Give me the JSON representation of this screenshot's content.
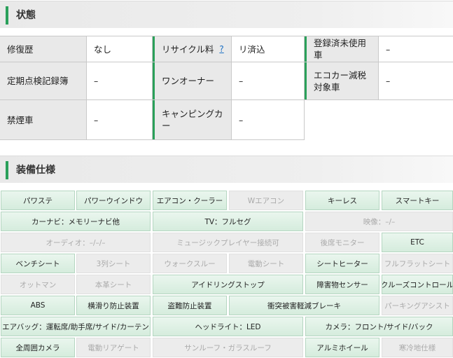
{
  "status": {
    "title": "状態",
    "rows": [
      [
        {
          "label": "修復歴",
          "value": "なし"
        },
        {
          "label": "リサイクル料",
          "help": "?",
          "value": "リ済込"
        },
        {
          "label": "登録済未使用車",
          "value": "–"
        }
      ],
      [
        {
          "label": "定期点検記録簿",
          "value": "–"
        },
        {
          "label": "ワンオーナー",
          "value": "–"
        },
        {
          "label": "エコカー減税対象車",
          "value": "–"
        }
      ],
      [
        {
          "label": "禁煙車",
          "value": "–"
        },
        {
          "label": "キャンピングカー",
          "value": "–"
        }
      ]
    ]
  },
  "equipment": {
    "title": "装備仕様",
    "items": [
      {
        "label": "パワステ",
        "on": true
      },
      {
        "label": "パワーウインドウ",
        "on": true
      },
      {
        "label": "エアコン・クーラー",
        "on": true
      },
      {
        "label": "Wエアコン",
        "on": false
      },
      {
        "label": "キーレス",
        "on": true
      },
      {
        "label": "スマートキー",
        "on": true
      },
      {
        "label": "カーナビ：メモリーナビ他",
        "on": true
      },
      {
        "label": "TV：フルセグ",
        "on": true
      },
      {
        "label": "映像：–/–",
        "on": false
      },
      {
        "label": "オーディオ：–/–/–",
        "on": false
      },
      {
        "label": "ミュージックプレイヤー接続可",
        "on": false
      },
      {
        "label": "後席モニター",
        "on": false
      },
      {
        "label": "ETC",
        "on": true
      },
      {
        "label": "ベンチシート",
        "on": true
      },
      {
        "label": "3列シート",
        "on": false
      },
      {
        "label": "ウォークスルー",
        "on": false
      },
      {
        "label": "電動シート",
        "on": false
      },
      {
        "label": "シートヒーター",
        "on": true
      },
      {
        "label": "フルフラットシート",
        "on": false
      },
      {
        "label": "オットマン",
        "on": false
      },
      {
        "label": "本革シート",
        "on": false
      },
      {
        "label": "アイドリングストップ",
        "on": true
      },
      {
        "label": "障害物センサー",
        "on": true
      },
      {
        "label": "クルーズコントロール",
        "on": true
      },
      {
        "label": "ABS",
        "on": true
      },
      {
        "label": "横滑り防止装置",
        "on": true
      },
      {
        "label": "盗難防止装置",
        "on": true
      },
      {
        "label": "衝突被害軽減ブレーキ",
        "on": true
      },
      {
        "label": "パーキングアシスト",
        "on": false
      },
      {
        "label": "エアバッグ：運転席/助手席/サイド/カーテン",
        "on": true
      },
      {
        "label": "ヘッドライト：LED",
        "on": true
      },
      {
        "label": "カメラ：フロント/サイド/バック",
        "on": true
      },
      {
        "label": "全周囲カメラ",
        "on": true
      },
      {
        "label": "電動リアゲート",
        "on": false
      },
      {
        "label": "サンルーフ・ガラスルーフ",
        "on": false
      },
      {
        "label": "アルミホイール",
        "on": true
      },
      {
        "label": "寒冷地仕様",
        "on": false
      }
    ]
  }
}
